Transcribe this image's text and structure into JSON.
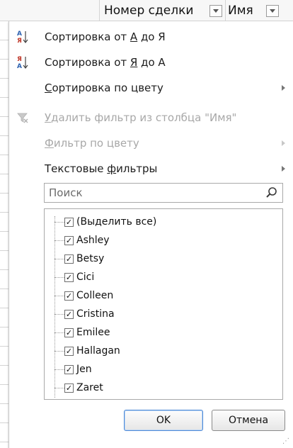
{
  "header": {
    "column1": "Номер сделки",
    "column2": "Имя"
  },
  "menu": {
    "sort_asc": "Сортировка от А до Я",
    "sort_asc_parts": [
      "Сортировка от ",
      "А",
      " до Я"
    ],
    "sort_desc_parts": [
      "Сортировка от ",
      "Я",
      " до А"
    ],
    "sort_by_color_parts": [
      "С",
      "ортировка по цвету"
    ],
    "clear_filter_parts": [
      "У",
      "далить фильтр из столбца \"Имя\""
    ],
    "filter_by_color_parts": [
      "Ф",
      "ильтр по цвету"
    ],
    "text_filters_parts": [
      "Текстовые ",
      "ф",
      "ильтры"
    ]
  },
  "search": {
    "placeholder": "Поиск"
  },
  "filter_list": {
    "items": [
      {
        "label": "(Выделить все)",
        "checked": true
      },
      {
        "label": "Ashley",
        "checked": true
      },
      {
        "label": "Betsy",
        "checked": true
      },
      {
        "label": "Cici",
        "checked": true
      },
      {
        "label": "Colleen",
        "checked": true
      },
      {
        "label": "Cristina",
        "checked": true
      },
      {
        "label": "Emilee",
        "checked": true
      },
      {
        "label": "Hallagan",
        "checked": true
      },
      {
        "label": "Jen",
        "checked": true
      },
      {
        "label": "Zaret",
        "checked": true
      }
    ]
  },
  "buttons": {
    "ok": "OK",
    "cancel": "Отмена"
  },
  "icons": {
    "sort_asc": "sort-a-to-z-icon",
    "sort_desc": "sort-z-to-a-icon",
    "clear_filter": "clear-filter-icon",
    "search": "search-icon",
    "check": "✓"
  },
  "colors": {
    "accent": "#4f8ad6",
    "disabled_text": "#a8a8a8"
  }
}
